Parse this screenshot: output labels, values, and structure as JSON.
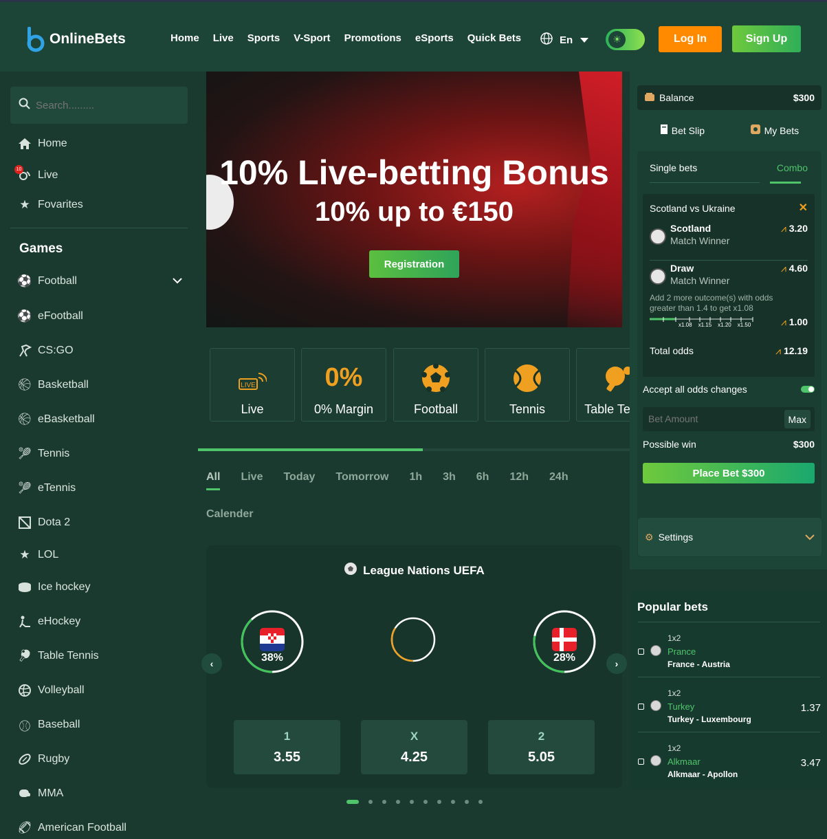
{
  "header": {
    "brand": "OnlineBets",
    "nav": [
      "Home",
      "Live",
      "Sports",
      "V-Sport",
      "Promotions",
      "eSports",
      "Quick Bets"
    ],
    "language": "En",
    "login_label": "Log In",
    "signup_label": "Sign Up"
  },
  "sidebar": {
    "search_placeholder": "Search.........",
    "top_items": [
      {
        "label": "Home",
        "icon": "home-icon"
      },
      {
        "label": "Live",
        "icon": "live-icon",
        "badge": "10"
      },
      {
        "label": "Fovarites",
        "icon": "star-icon"
      }
    ],
    "games_title": "Games",
    "games": [
      {
        "label": "Football",
        "icon": "football-icon"
      },
      {
        "label": "eFootball",
        "icon": "football-icon"
      },
      {
        "label": "CS:GO",
        "icon": "shooter-icon"
      },
      {
        "label": "Basketball",
        "icon": "basketball-icon"
      },
      {
        "label": "eBasketball",
        "icon": "basketball-icon"
      },
      {
        "label": "Tennis",
        "icon": "tennis-icon"
      },
      {
        "label": "eTennis",
        "icon": "tennis-icon"
      },
      {
        "label": "Dota 2",
        "icon": "dota-icon"
      },
      {
        "label": "LOL",
        "icon": "star-icon"
      },
      {
        "label": "Ice hockey",
        "icon": "puck-icon"
      },
      {
        "label": "eHockey",
        "icon": "hockey-icon"
      },
      {
        "label": "Table Tennis",
        "icon": "table-tennis-icon"
      },
      {
        "label": "Volleyball",
        "icon": "volleyball-icon"
      },
      {
        "label": "Baseball",
        "icon": "baseball-icon"
      },
      {
        "label": "Rugby",
        "icon": "rugby-icon"
      },
      {
        "label": "MMA",
        "icon": "mma-icon"
      },
      {
        "label": "American Football",
        "icon": "american-football-icon"
      }
    ]
  },
  "banner": {
    "title": "10% Live-betting Bonus",
    "subtitle": "10% up to €150",
    "cta": "Registration"
  },
  "categories": [
    {
      "label": "Live",
      "icon": "live-icon",
      "badge": "LIVE"
    },
    {
      "label": "0% Margin",
      "icon": "zero-percent-icon",
      "badge": "0%"
    },
    {
      "label": "Football",
      "icon": "football-icon"
    },
    {
      "label": "Tennis",
      "icon": "tennis-icon"
    },
    {
      "label": "Table Tennis",
      "icon": "table-tennis-icon"
    }
  ],
  "category_scroll_fraction": 0.52,
  "filters": [
    "All",
    "Live",
    "Today",
    "Tomorrow",
    "1h",
    "3h",
    "6h",
    "12h",
    "24h"
  ],
  "calendar_label": "Calender",
  "match": {
    "league": "League Nations UEFA",
    "home_pct": "38%",
    "home_fraction": 0.38,
    "away_pct": "28%",
    "away_fraction": 0.28,
    "draw_fraction": 0.34,
    "odds": [
      {
        "label": "1",
        "value": "3.55"
      },
      {
        "label": "X",
        "value": "4.25"
      },
      {
        "label": "2",
        "value": "5.05"
      }
    ]
  },
  "carousel_pages": 10,
  "carousel_active": 1,
  "betslip": {
    "balance_label": "Balance",
    "balance_value": "$300",
    "bet_slip_label": "Bet Slip",
    "my_bets_label": "My Bets",
    "single_label": "Single bets",
    "combo_label": "Combo",
    "event": "Scotland vs Ukraine",
    "selections": [
      {
        "name": "Scotland",
        "market": "Match Winner",
        "odd": "3.20"
      },
      {
        "name": "Draw",
        "market": "Match Winner",
        "odd": "4.60"
      }
    ],
    "hint": "Add 2 more outcome(s) with odds greater than 1.4 to get x1.08",
    "multipliers": [
      "x1.08",
      "x1.15",
      "x1.20",
      "x1.50"
    ],
    "current_multiplier": "1.00",
    "total_odds_label": "Total odds",
    "total_odds": "12.19",
    "accept_label": "Accept all odds changes",
    "amount_placeholder": "Bet Amount",
    "max_label": "Max",
    "possible_win_label": "Possible win",
    "possible_win": "$300",
    "place_label": "Place Bet $300",
    "settings_label": "Settings"
  },
  "popular": {
    "title": "Popular bets",
    "items": [
      {
        "market": "1x2",
        "pick": "Prance",
        "match": "France - Austria",
        "odd": ""
      },
      {
        "market": "1x2",
        "pick": "Turkey",
        "match": "Turkey - Luxembourg",
        "odd": "1.37"
      },
      {
        "market": "1x2",
        "pick": "Alkmaar",
        "match": "Alkmaar - Apollon",
        "odd": "3.47"
      }
    ]
  },
  "colors": {
    "accent": "#4fc46a",
    "login": "#ff8a00",
    "background": "#1a3a30"
  }
}
